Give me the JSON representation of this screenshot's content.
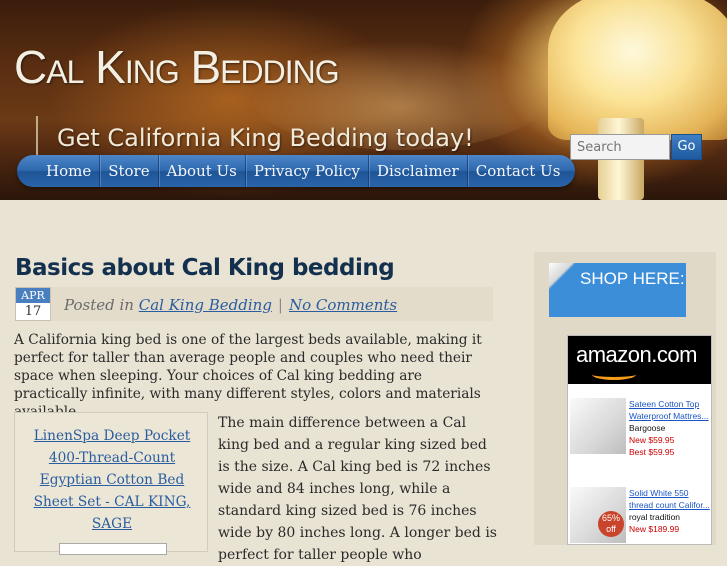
{
  "site": {
    "title": "Cal King Bedding",
    "tagline": "Get California King Bedding today!"
  },
  "search": {
    "placeholder": "Search",
    "button_label": "Go"
  },
  "nav": {
    "items": [
      "Home",
      "Store",
      "About Us",
      "Privacy Policy",
      "Disclaimer",
      "Contact Us"
    ]
  },
  "post": {
    "title": "Basics about Cal King bedding",
    "date_month": "APR",
    "date_day": "17",
    "posted_in_prefix": "Posted in",
    "category": "Cal King Bedding",
    "separator": "|",
    "comments": "No Comments",
    "intro": "A California king bed is one of the largest beds available, making it perfect for taller than average people and couples who need their space when sleeping. Your choices of Cal king bedding are practically infinite, with many different styles, colors and materials available.",
    "product_link": "LinenSpa Deep Pocket 400-Thread-Count Egyptian Cotton Bed Sheet Set - CAL KING, SAGE",
    "body": "The main difference between a Cal king bed and a regular king sized bed is the size. A Cal king bed is 72 inches wide and 84 inches long, while a standard king sized bed is 76 inches wide by 80 inches long. A longer bed is perfect for taller people who"
  },
  "sidebar": {
    "shop_label": "SHOP HERE:",
    "amazon_logo": "amazon.com",
    "items": [
      {
        "title": "Sateen Cotton Top Waterproof Mattres...",
        "brand": "Bargoose",
        "new_price": "New $59.95",
        "best_price": "Best $59.95"
      },
      {
        "title": "Solid White 550 thread count Califor...",
        "brand": "royal tradition",
        "new_price": "New $189.99",
        "badge": "65% off"
      }
    ]
  },
  "colors": {
    "nav_blue": "#2f68ad",
    "link_blue": "#2a5d9f",
    "title_navy": "#14304f",
    "page_bg": "#e9e3d3"
  }
}
